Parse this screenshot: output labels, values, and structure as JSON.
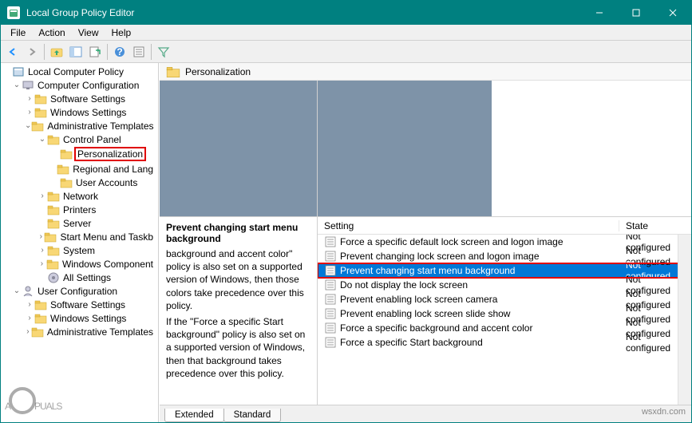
{
  "titlebar": {
    "title": "Local Group Policy Editor"
  },
  "menubar": {
    "items": [
      "File",
      "Action",
      "View",
      "Help"
    ]
  },
  "tree": {
    "root": "Local Computer Policy",
    "cc": "Computer Configuration",
    "cc_children": {
      "software": "Software Settings",
      "windows": "Windows Settings",
      "admin": "Administrative Templates",
      "cp": "Control Panel",
      "pers": "Personalization",
      "regional": "Regional and Lang",
      "ua": "User Accounts",
      "network": "Network",
      "printers": "Printers",
      "server": "Server",
      "start": "Start Menu and Taskb",
      "system": "System",
      "wincomp": "Windows Component",
      "allset": "All Settings"
    },
    "uc": "User Configuration",
    "uc_children": {
      "software": "Software Settings",
      "windows": "Windows Settings",
      "admin": "Administrative Templates"
    }
  },
  "header": {
    "title": "Personalization"
  },
  "description": {
    "title": "Prevent changing start menu background",
    "p1_cut": "background and accent color\" policy is also set on a supported version of Windows, then those colors take precedence over this policy.",
    "p2": "If the \"Force a specific Start background\" policy is also set on a supported version of Windows, then that background takes precedence over this policy."
  },
  "list": {
    "col_setting": "Setting",
    "col_state": "State",
    "rows": [
      {
        "label": "Force a specific default lock screen and logon image",
        "state": "Not configured",
        "selected": false
      },
      {
        "label": "Prevent changing lock screen and logon image",
        "state": "Not configured",
        "selected": false
      },
      {
        "label": "Prevent changing start menu background",
        "state": "Not configured",
        "selected": true
      },
      {
        "label": "Do not display the lock screen",
        "state": "Not configured",
        "selected": false
      },
      {
        "label": "Prevent enabling lock screen camera",
        "state": "Not configured",
        "selected": false
      },
      {
        "label": "Prevent enabling lock screen slide show",
        "state": "Not configured",
        "selected": false
      },
      {
        "label": "Force a specific background and accent color",
        "state": "Not configured",
        "selected": false
      },
      {
        "label": "Force a specific Start background",
        "state": "Not configured",
        "selected": false
      }
    ]
  },
  "tabs": {
    "extended": "Extended",
    "standard": "Standard"
  },
  "watermark": {
    "text_a": "A",
    "text_b": "PUALS"
  },
  "wsx": "wsxdn.com"
}
